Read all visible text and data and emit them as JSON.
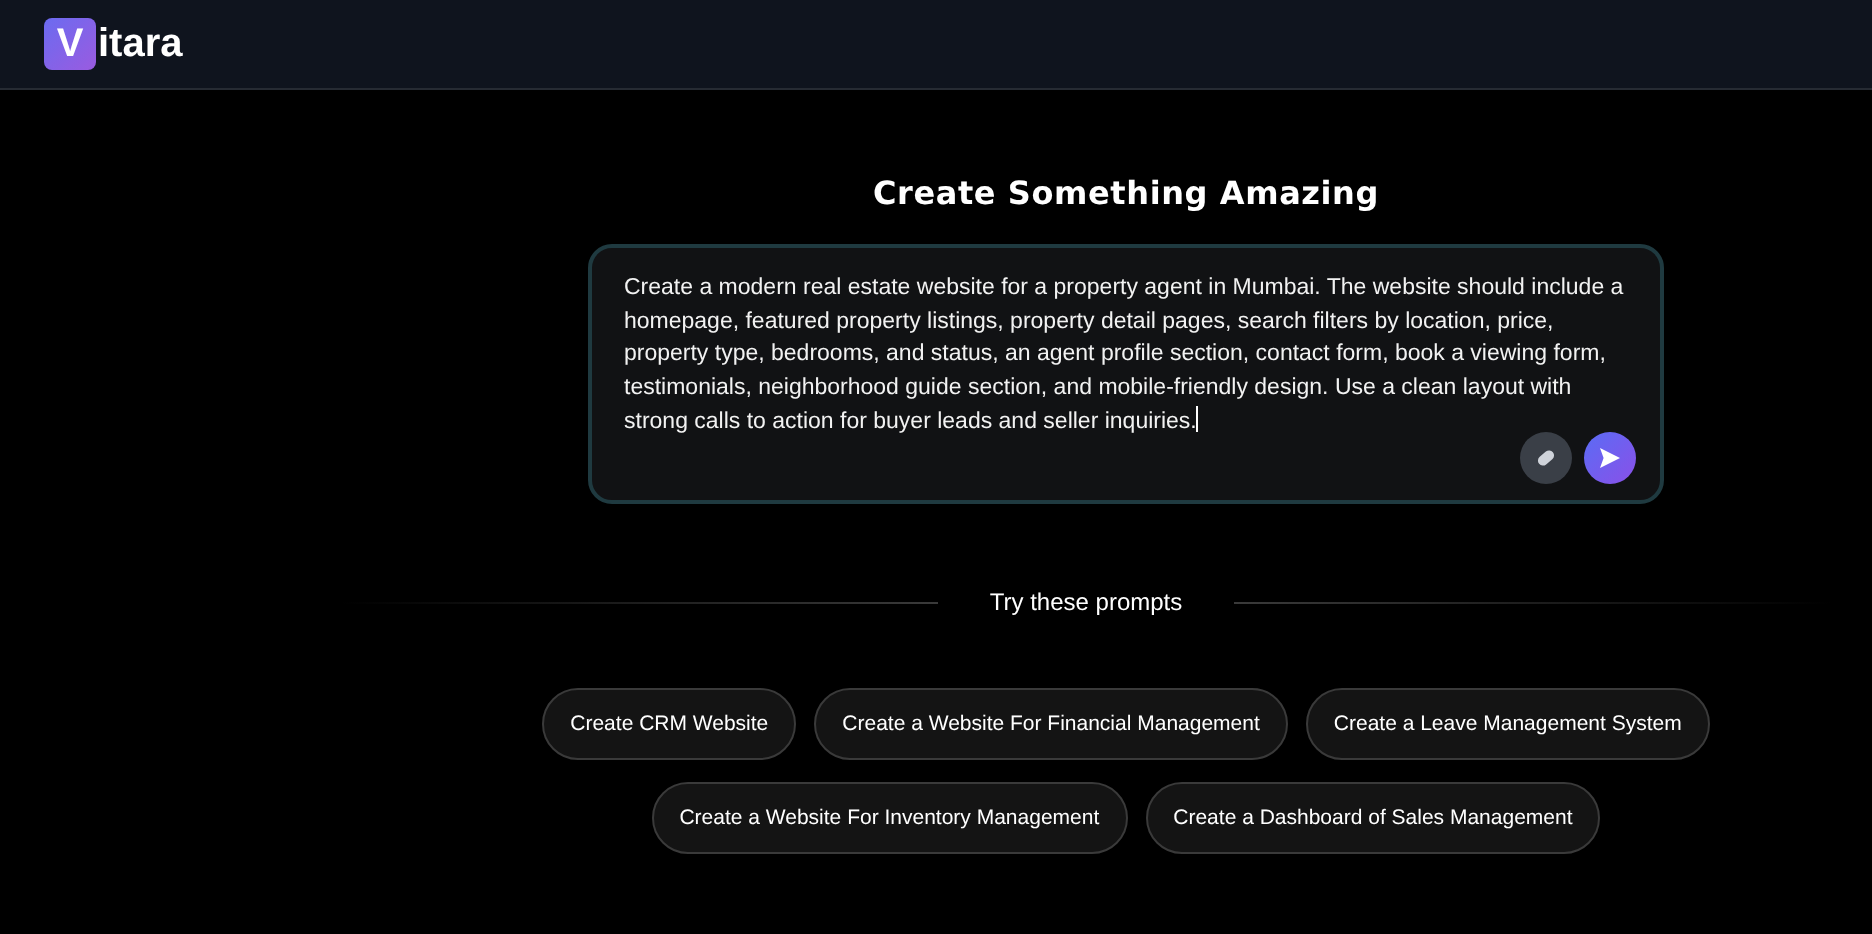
{
  "header": {
    "logo_mark": "V",
    "logo_rest": "itara"
  },
  "heading": "Create Something Amazing",
  "prompt": {
    "value": "Create a modern real estate website for a property agent in Mumbai. The website should include a homepage, featured property listings, property detail pages, search filters by location, price, property type, bedrooms, and status, an agent profile section, contact form, book a viewing form, testimonials, neighborhood guide section, and mobile-friendly design. Use a clean layout with strong calls to action for buyer leads and seller inquiries."
  },
  "suggestions_title": "Try these prompts",
  "suggestions": [
    "Create CRM Website",
    "Create a Website For Financial Management",
    "Create a Leave Management System",
    "Create a Website For Inventory Management",
    "Create a Dashboard of Sales Management"
  ]
}
